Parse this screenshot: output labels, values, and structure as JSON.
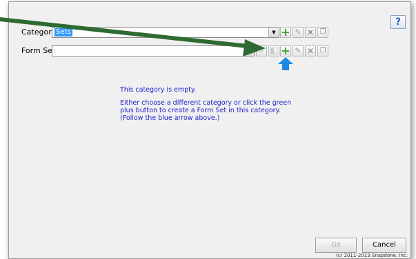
{
  "dialog": {
    "help_label": "?",
    "category": {
      "label": "Category",
      "value": "Sets"
    },
    "form_set": {
      "label": "Form Set",
      "value": ""
    },
    "message": {
      "line1": "This category is empty.",
      "line2": "Either choose a different category or click the green plus button to create a Form Set in this category.  (Follow the blue arrow above.)"
    },
    "buttons": {
      "go": "Go",
      "cancel": "Cancel"
    },
    "copyright": "(c) 2011-2013 Snapdone, Inc."
  },
  "colors": {
    "arrow_green": "#2e6b32",
    "arrow_blue": "#1e88e5",
    "plus_green": "#3fa12d",
    "message_blue": "#2222cc"
  }
}
